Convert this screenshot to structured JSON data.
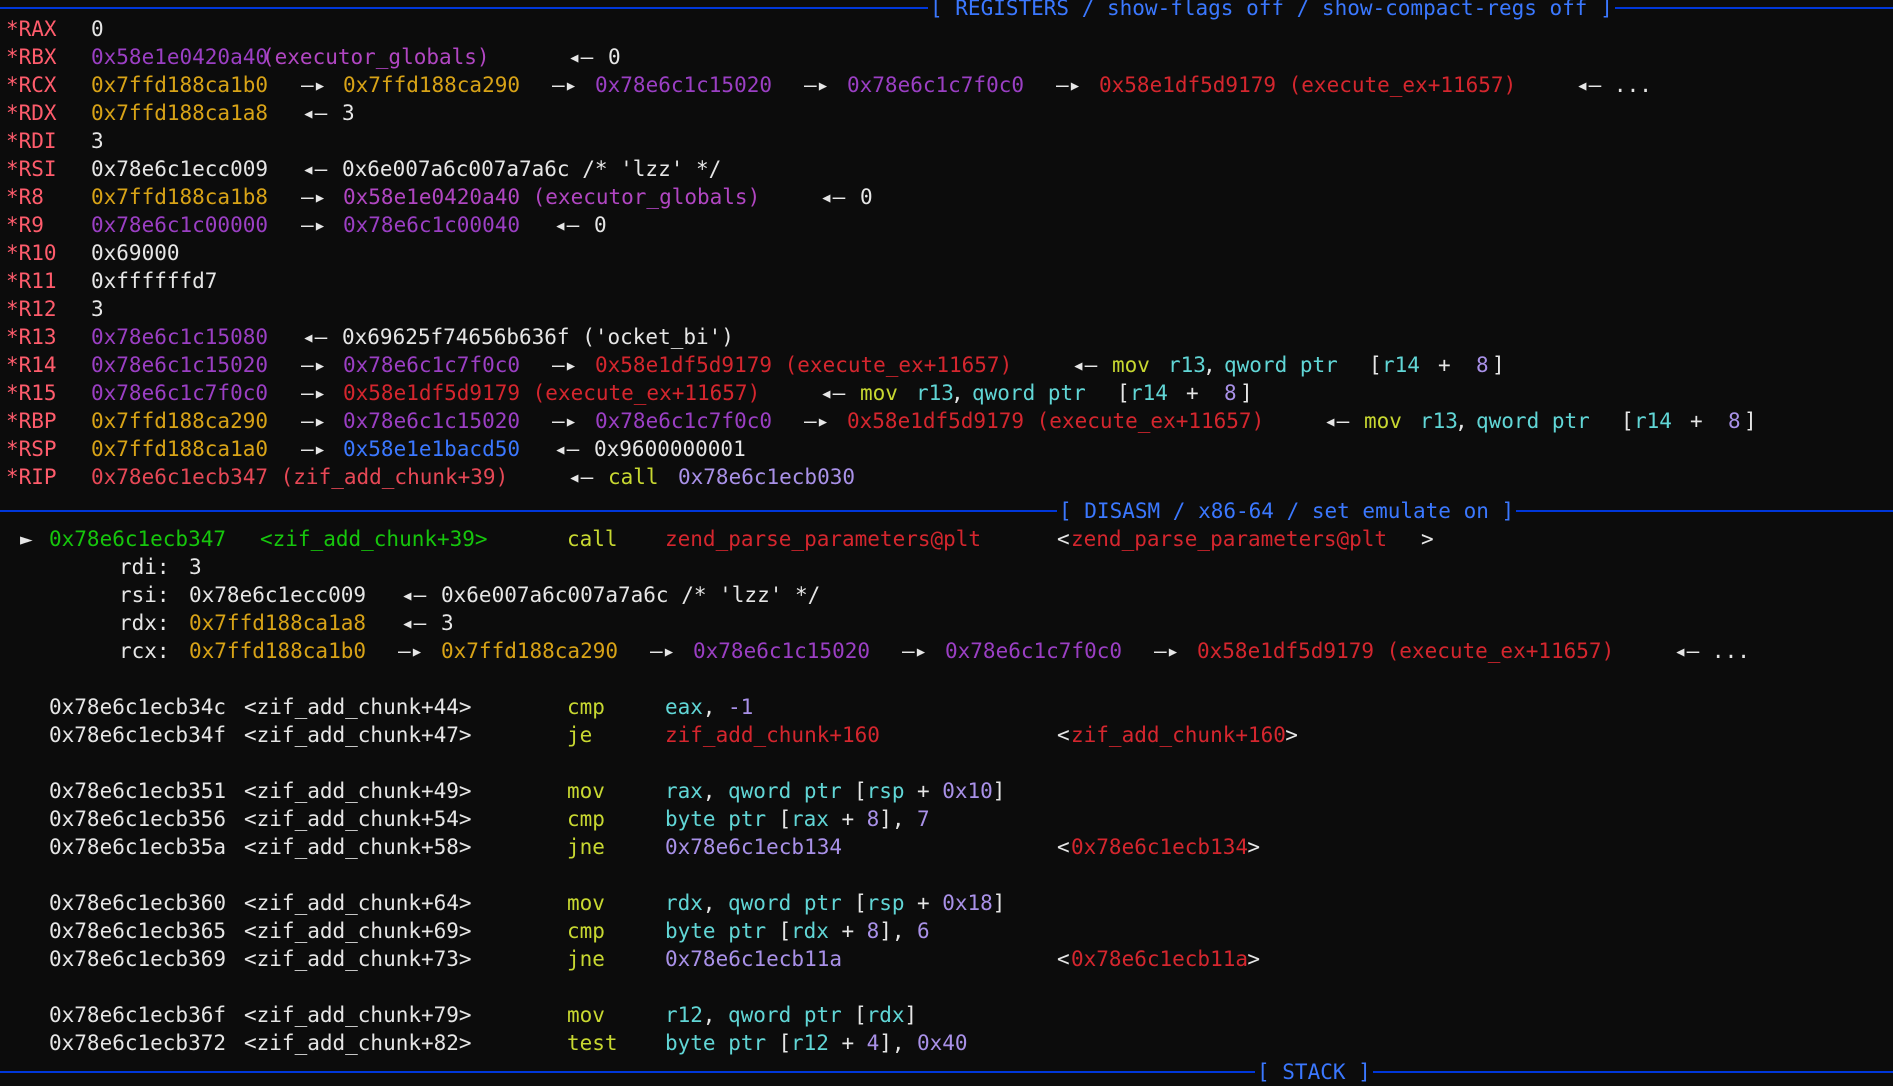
{
  "headers": {
    "registers": "[ REGISTERS / show-flags off / show-compact-regs off ]",
    "disasm": "[ DISASM / x86-64 / set emulate on ]",
    "stack": "[ STACK ]"
  },
  "registers": [
    {
      "name": "*RAX",
      "value": "0"
    },
    {
      "name": "*RBX",
      "addr": "0x58e1e0420a40",
      "sym": "(executor_globals)",
      "arrow": "◂—",
      "tail": "0"
    },
    {
      "name": "*RCX",
      "chain": [
        "0x7ffd188ca1b0",
        "0x7ffd188ca290",
        "0x78e6c1c15020",
        "0x78e6c1c7f0c0",
        "0x58e1df5d9179 (execute_ex+11657)"
      ],
      "tail": "◂— ..."
    },
    {
      "name": "*RDX",
      "addr": "0x7ffd188ca1a8",
      "arrow": "◂—",
      "tail": "3"
    },
    {
      "name": "*RDI",
      "value": "3"
    },
    {
      "name": "*RSI",
      "addr": "0x78e6c1ecc009",
      "arrow": "◂—",
      "tail": "0x6e007a6c007a7a6c /* 'lzz' */"
    },
    {
      "name": "*R8",
      "addr": "0x7ffd188ca1b8",
      "mid": "0x58e1e0420a40 (executor_globals)",
      "arrow": "◂—",
      "tail": "0"
    },
    {
      "name": "*R9",
      "addr": "0x78e6c1c00000",
      "mid": "0x78e6c1c00040",
      "arrow": "◂—",
      "tail": "0"
    },
    {
      "name": "*R10",
      "value": "0x69000"
    },
    {
      "name": "*R11",
      "value": "0xffffffd7"
    },
    {
      "name": "*R12",
      "value": "3"
    },
    {
      "name": "*R13",
      "addr": "0x78e6c1c15080",
      "arrow": "◂—",
      "tail": "0x69625f74656b636f ('ocket_bi')"
    },
    {
      "name": "*R14",
      "chain": [
        "0x78e6c1c15020",
        "0x78e6c1c7f0c0",
        "0x58e1df5d9179 (execute_ex+11657)"
      ],
      "arrow": "◂—",
      "insn": {
        "mnem": "mov",
        "a": "r13",
        "b": "qword ptr",
        "c": "r14",
        "d": "8"
      }
    },
    {
      "name": "*R15",
      "chain": [
        "0x78e6c1c7f0c0",
        "0x58e1df5d9179 (execute_ex+11657)"
      ],
      "arrow": "◂—",
      "insn": {
        "mnem": "mov",
        "a": "r13",
        "b": "qword ptr",
        "c": "r14",
        "d": "8"
      }
    },
    {
      "name": "*RBP",
      "chain": [
        "0x7ffd188ca290",
        "0x78e6c1c15020",
        "0x78e6c1c7f0c0",
        "0x58e1df5d9179 (execute_ex+11657)"
      ],
      "arrow": "◂—",
      "insn": {
        "mnem": "mov",
        "a": "r13",
        "b": "qword ptr",
        "c": "r14",
        "d": "8"
      }
    },
    {
      "name": "*RSP",
      "addr": "0x7ffd188ca1a0",
      "mid": "0x58e1e1bacd50",
      "arrow": "◂—",
      "tail": "0x9600000001"
    },
    {
      "name": "*RIP",
      "addr": "0x78e6c1ecb347 (zif_add_chunk+39)",
      "arrow": "◂—",
      "mnem": "call",
      "target": "0x78e6c1ecb030"
    }
  ],
  "arrow_chain": "—▸",
  "disasm": {
    "current_marker": "►",
    "current": {
      "addr": "0x78e6c1ecb347",
      "sym": "<zif_add_chunk+39>",
      "mnem": "call",
      "op": "zend_parse_parameters@plt",
      "lt": "<",
      "target": "zend_parse_parameters@plt",
      "gt": ">"
    },
    "args": [
      {
        "name": "rdi:",
        "value": "3"
      },
      {
        "name": "rsi:",
        "addr": "0x78e6c1ecc009",
        "arrow": "◂—",
        "tail": "0x6e007a6c007a7a6c /* 'lzz' */"
      },
      {
        "name": "rdx:",
        "addr": "0x7ffd188ca1a8",
        "arrow": "◂—",
        "tail": "3"
      },
      {
        "name": "rcx:",
        "chain": [
          "0x7ffd188ca1b0",
          "0x7ffd188ca290",
          "0x78e6c1c15020",
          "0x78e6c1c7f0c0",
          "0x58e1df5d9179 (execute_ex+11657)"
        ],
        "tail": "◂— ..."
      }
    ],
    "rows": [
      {
        "addr": "0x78e6c1ecb34c",
        "sym": "<zif_add_chunk+44>",
        "mnem": "cmp",
        "ops": [
          {
            "t": "eax",
            "k": "cyan"
          },
          {
            "t": ", ",
            "k": "white"
          },
          {
            "t": "-1",
            "k": "lav"
          }
        ]
      },
      {
        "addr": "0x78e6c1ecb34f",
        "sym": "<zif_add_chunk+47>",
        "mnem": "je",
        "ops": [
          {
            "t": "zif_add_chunk+160",
            "k": "crim"
          }
        ],
        "target": "zif_add_chunk+160"
      },
      {
        "addr": "0x78e6c1ecb351",
        "sym": "<zif_add_chunk+49>",
        "mnem": "mov",
        "ops": [
          {
            "t": "rax",
            "k": "cyan"
          },
          {
            "t": ", ",
            "k": "white"
          },
          {
            "t": "qword ptr",
            "k": "cyan"
          },
          {
            "t": " [",
            "k": "white"
          },
          {
            "t": "rsp",
            "k": "cyan"
          },
          {
            "t": " + ",
            "k": "white"
          },
          {
            "t": "0x10",
            "k": "lav"
          },
          {
            "t": "]",
            "k": "white"
          }
        ]
      },
      {
        "addr": "0x78e6c1ecb356",
        "sym": "<zif_add_chunk+54>",
        "mnem": "cmp",
        "ops": [
          {
            "t": "byte ptr",
            "k": "cyan"
          },
          {
            "t": " [",
            "k": "white"
          },
          {
            "t": "rax",
            "k": "cyan"
          },
          {
            "t": " + ",
            "k": "white"
          },
          {
            "t": "8",
            "k": "lav"
          },
          {
            "t": "], ",
            "k": "white"
          },
          {
            "t": "7",
            "k": "lav"
          }
        ]
      },
      {
        "addr": "0x78e6c1ecb35a",
        "sym": "<zif_add_chunk+58>",
        "mnem": "jne",
        "ops": [
          {
            "t": "0x78e6c1ecb134",
            "k": "lav"
          }
        ],
        "target": "0x78e6c1ecb134"
      },
      {
        "addr": "0x78e6c1ecb360",
        "sym": "<zif_add_chunk+64>",
        "mnem": "mov",
        "ops": [
          {
            "t": "rdx",
            "k": "cyan"
          },
          {
            "t": ", ",
            "k": "white"
          },
          {
            "t": "qword ptr",
            "k": "cyan"
          },
          {
            "t": " [",
            "k": "white"
          },
          {
            "t": "rsp",
            "k": "cyan"
          },
          {
            "t": " + ",
            "k": "white"
          },
          {
            "t": "0x18",
            "k": "lav"
          },
          {
            "t": "]",
            "k": "white"
          }
        ]
      },
      {
        "addr": "0x78e6c1ecb365",
        "sym": "<zif_add_chunk+69>",
        "mnem": "cmp",
        "ops": [
          {
            "t": "byte ptr",
            "k": "cyan"
          },
          {
            "t": " [",
            "k": "white"
          },
          {
            "t": "rdx",
            "k": "cyan"
          },
          {
            "t": " + ",
            "k": "white"
          },
          {
            "t": "8",
            "k": "lav"
          },
          {
            "t": "], ",
            "k": "white"
          },
          {
            "t": "6",
            "k": "lav"
          }
        ]
      },
      {
        "addr": "0x78e6c1ecb369",
        "sym": "<zif_add_chunk+73>",
        "mnem": "jne",
        "ops": [
          {
            "t": "0x78e6c1ecb11a",
            "k": "lav"
          }
        ],
        "target": "0x78e6c1ecb11a"
      },
      {
        "addr": "0x78e6c1ecb36f",
        "sym": "<zif_add_chunk+79>",
        "mnem": "mov",
        "ops": [
          {
            "t": "r12",
            "k": "cyan"
          },
          {
            "t": ", ",
            "k": "white"
          },
          {
            "t": "qword ptr",
            "k": "cyan"
          },
          {
            "t": " [",
            "k": "white"
          },
          {
            "t": "rdx",
            "k": "cyan"
          },
          {
            "t": "]",
            "k": "white"
          }
        ]
      },
      {
        "addr": "0x78e6c1ecb372",
        "sym": "<zif_add_chunk+82>",
        "mnem": "test",
        "ops": [
          {
            "t": "byte ptr",
            "k": "cyan"
          },
          {
            "t": " [",
            "k": "white"
          },
          {
            "t": "r12",
            "k": "cyan"
          },
          {
            "t": " + ",
            "k": "white"
          },
          {
            "t": "4",
            "k": "lav"
          },
          {
            "t": "], ",
            "k": "white"
          },
          {
            "t": "0x40",
            "k": "lav"
          }
        ]
      }
    ]
  }
}
